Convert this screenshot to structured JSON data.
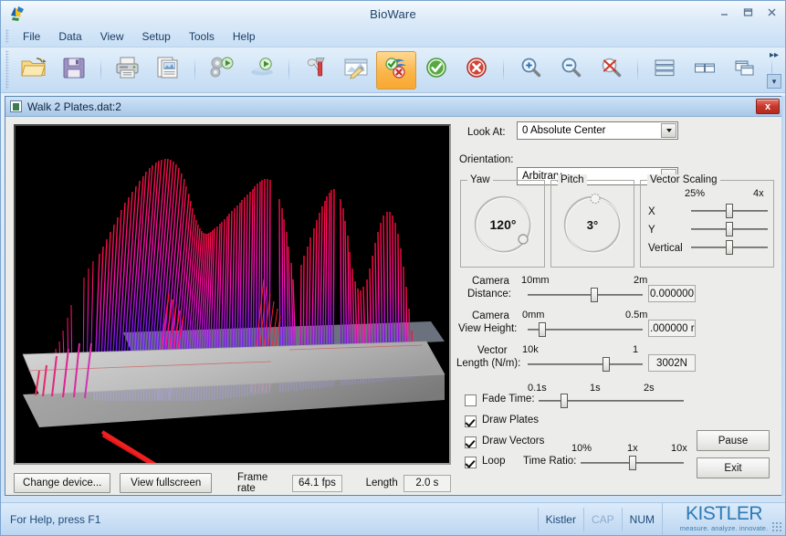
{
  "window": {
    "title": "BioWare",
    "app_icon": "bioware-logo-icon",
    "minimize": "minimize-icon",
    "maximize": "maximize-icon",
    "close": "close-icon"
  },
  "menu": {
    "items": [
      {
        "label": "File"
      },
      {
        "label": "Data"
      },
      {
        "label": "View"
      },
      {
        "label": "Setup"
      },
      {
        "label": "Tools"
      },
      {
        "label": "Help"
      }
    ]
  },
  "toolbar": {
    "buttons": [
      {
        "name": "open-icon",
        "tip": "Open"
      },
      {
        "name": "save-icon",
        "tip": "Save"
      },
      {
        "name": "print-icon",
        "tip": "Print"
      },
      {
        "name": "report-icon",
        "tip": "Report"
      },
      {
        "name": "process-run-icon",
        "tip": "Process"
      },
      {
        "name": "play-icon",
        "tip": "Play"
      },
      {
        "name": "tools-icon",
        "tip": "Tools"
      },
      {
        "name": "edit-graph-icon",
        "tip": "Edit Graph"
      },
      {
        "name": "validate-toggle-icon",
        "tip": "Validate",
        "active": true
      },
      {
        "name": "accept-icon",
        "tip": "Accept"
      },
      {
        "name": "reject-icon",
        "tip": "Reject"
      },
      {
        "name": "zoom-in-icon",
        "tip": "Zoom In"
      },
      {
        "name": "zoom-out-icon",
        "tip": "Zoom Out"
      },
      {
        "name": "zoom-reset-icon",
        "tip": "Reset Zoom"
      },
      {
        "name": "tile-horizontal-icon",
        "tip": "Tile Horizontally"
      },
      {
        "name": "tile-vertical-icon",
        "tip": "Tile Vertically"
      },
      {
        "name": "cascade-icon",
        "tip": "Cascade"
      }
    ],
    "overflow_label": "»"
  },
  "document": {
    "title": "Walk 2 Plates.dat:2",
    "close_label": "x"
  },
  "viewport": {
    "description": "3D ground reaction force vector plot over two force plates",
    "background": "#000000",
    "plate_color": "#b4b4b4",
    "vector_colors": [
      "#ff0d3c",
      "#ff00d0",
      "#6a14ff",
      "#2a2aff"
    ],
    "arrow_color": "#e51414"
  },
  "look_at": {
    "label": "Look At:",
    "value": "0 Absolute Center"
  },
  "orientation": {
    "label": "Orientation:",
    "value": "Arbitrary"
  },
  "yaw": {
    "title": "Yaw",
    "value": "120°"
  },
  "pitch": {
    "title": "Pitch",
    "value": "3°"
  },
  "vector_scaling": {
    "title": "Vector Scaling",
    "min_label": "25%",
    "max_label": "4x",
    "axes": [
      {
        "label": "X",
        "pos_pct": 50
      },
      {
        "label": "Y",
        "pos_pct": 50
      },
      {
        "label": "Vertical",
        "pos_pct": 50
      }
    ]
  },
  "camera_distance": {
    "label_line1": "Camera",
    "label_line2": "Distance:",
    "min_label": "10mm",
    "max_label": "2m",
    "pos_pct": 56,
    "value": "0.000000"
  },
  "camera_view_height": {
    "label_line1": "Camera",
    "label_line2": "View Height:",
    "min_label": "0mm",
    "max_label": "0.5m",
    "pos_pct": 11,
    "value": ".000000 r"
  },
  "vector_length": {
    "label_line1": "Vector",
    "label_line2": "Length (N/m):",
    "min_label": "10k",
    "max_label": "1",
    "pos_pct": 66,
    "value": "3002N"
  },
  "fade_time": {
    "label": "Fade Time:",
    "checked": false,
    "ticks": [
      "0.1s",
      "1s",
      "2s"
    ],
    "pos_pct": 16
  },
  "draw_plates": {
    "label": "Draw Plates",
    "checked": true
  },
  "draw_vectors": {
    "label": "Draw Vectors",
    "checked": true
  },
  "loop": {
    "label": "Loop",
    "checked": true
  },
  "time_ratio": {
    "label": "Time Ratio:",
    "ticks": [
      "10%",
      "1x",
      "10x"
    ],
    "pos_pct": 50
  },
  "buttons": {
    "pause": "Pause",
    "exit": "Exit",
    "change_device": "Change device...",
    "view_fullscreen": "View fullscreen"
  },
  "frame_rate": {
    "label": "Frame rate",
    "value": "64.1 fps"
  },
  "length": {
    "label": "Length",
    "value": "2.0 s"
  },
  "statusbar": {
    "help_text": "For Help, press F1",
    "cells": [
      {
        "label": "Kistler",
        "dim": false
      },
      {
        "label": "CAP",
        "dim": true
      },
      {
        "label": "NUM",
        "dim": false
      }
    ],
    "brand": "KISTLER",
    "tagline": "measure. analyze. innovate."
  }
}
